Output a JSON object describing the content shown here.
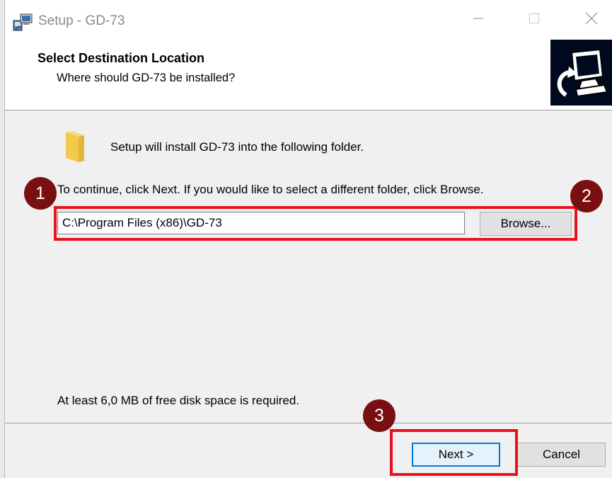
{
  "window": {
    "title": "Setup - GD-73"
  },
  "header": {
    "title": "Select Destination Location",
    "subtitle": "Where should GD-73 be installed?"
  },
  "body": {
    "install_message": "Setup will install GD-73 into the following folder.",
    "continue_message": "To continue, click Next. If you would like to select a different folder, click Browse.",
    "path_value": "C:\\Program Files (x86)\\GD-73",
    "browse_label": "Browse...",
    "disk_space_message": "At least 6,0 MB of free disk space is required."
  },
  "footer": {
    "next_label": "Next >",
    "cancel_label": "Cancel"
  },
  "annotations": {
    "step_1": "1",
    "step_2": "2",
    "step_3": "3",
    "highlight_color": "#e8121e",
    "badge_color": "#7a0f12"
  },
  "icons": {
    "app": "setup-app-icon",
    "folder": "folder-icon",
    "logo": "computer-install-logo-icon",
    "minimize": "minimize-icon",
    "maximize": "maximize-icon",
    "close": "close-icon"
  }
}
